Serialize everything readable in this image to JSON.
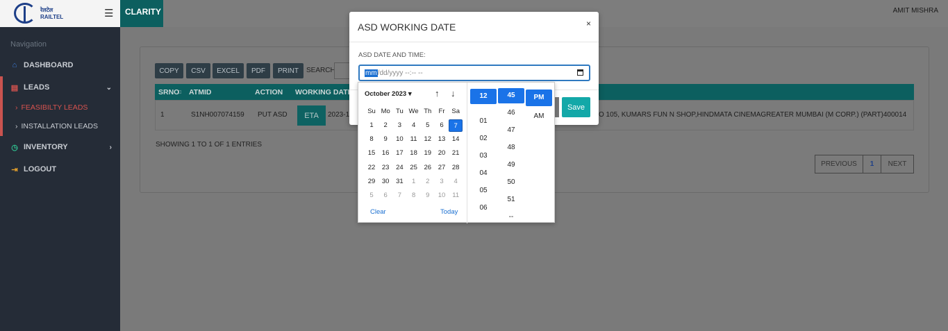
{
  "sidebar": {
    "logo_text_line1": "रेलटेल",
    "logo_text_line2": "RAILTEL",
    "nav_heading": "Navigation",
    "items": {
      "dashboard": "DASHBOARD",
      "leads": "LEADS",
      "feasibility": "FEASIBILTY LEADS",
      "installation": "INSTALLATION LEADS",
      "inventory": "INVENTORY",
      "logout": "LOGOUT"
    }
  },
  "header": {
    "brand": "CLARITY",
    "user": "AMIT MISHRA"
  },
  "toolbar": {
    "copy": "COPY",
    "csv": "CSV",
    "excel": "EXCEL",
    "pdf": "PDF",
    "print": "PRINT",
    "search_label": "SEARCH:"
  },
  "table": {
    "headers": {
      "srno": "SRNO",
      "atmid": "ATMID",
      "action": "ACTION",
      "working_date": "WORKING DATE"
    },
    "rows": [
      {
        "srno": "1",
        "atmid": "S1NH007074159",
        "action": "PUT ASD",
        "eta_label": "ETA",
        "working_date": "2023-1",
        "address": "O 105, KUMARS FUN N SHOP,HINDMATA CINEMAGREATER MUMBAI (M CORP.) (PART)400014"
      }
    ],
    "showing": "SHOWING 1 TO 1 OF 1 ENTRIES"
  },
  "pagination": {
    "previous": "PREVIOUS",
    "page": "1",
    "next": "NEXT"
  },
  "modal": {
    "title": "ASD WORKING DATE",
    "close": "×",
    "label": "ASD DATE AND TIME:",
    "input_mm": "mm",
    "input_rest": "/dd/yyyy --:-- --",
    "save": "Save"
  },
  "picker": {
    "month": "October 2023 ▾",
    "weekdays": [
      "Su",
      "Mo",
      "Tu",
      "We",
      "Th",
      "Fr",
      "Sa"
    ],
    "weeks": [
      [
        "1",
        "2",
        "3",
        "4",
        "5",
        "6",
        "7"
      ],
      [
        "8",
        "9",
        "10",
        "11",
        "12",
        "13",
        "14"
      ],
      [
        "15",
        "16",
        "17",
        "18",
        "19",
        "20",
        "21"
      ],
      [
        "22",
        "23",
        "24",
        "25",
        "26",
        "27",
        "28"
      ],
      [
        "29",
        "30",
        "31",
        "1",
        "2",
        "3",
        "4"
      ],
      [
        "5",
        "6",
        "7",
        "8",
        "9",
        "10",
        "11"
      ]
    ],
    "selected_day": "7",
    "clear": "Clear",
    "today": "Today",
    "hours": [
      "12",
      "01",
      "02",
      "03",
      "04",
      "05",
      "06"
    ],
    "minutes": [
      "45",
      "46",
      "47",
      "48",
      "49",
      "50",
      "51",
      "--"
    ],
    "ampm": [
      "PM",
      "AM"
    ],
    "selected_hour": "12",
    "selected_minute": "45",
    "selected_ampm": "PM"
  }
}
